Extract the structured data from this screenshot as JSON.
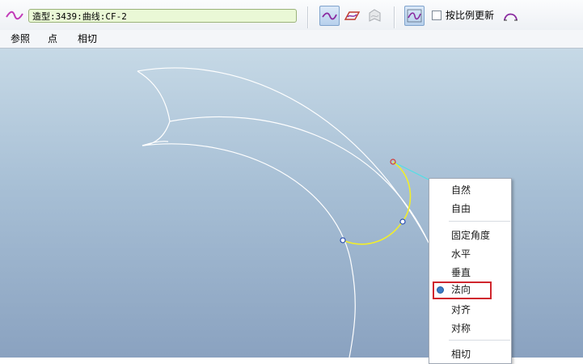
{
  "toolbar": {
    "curve_name": "造型:3439:曲线:CF-2",
    "buttons": [
      {
        "name": "curve-fit-button",
        "icon": "curve-tangent-icon",
        "active": true
      },
      {
        "name": "plane-curve-button",
        "icon": "planar-curve-icon",
        "active": false
      },
      {
        "name": "surface-curve-button",
        "icon": "surface-curve-icon",
        "active": false
      },
      {
        "name": "curvature-button",
        "icon": "curvature-plot-icon",
        "active": true
      },
      {
        "name": "proportional-update-button",
        "icon": "arch-icon",
        "active": false
      }
    ],
    "proportional_update_label": "按比例更新",
    "proportional_update_checked": false
  },
  "menubar": {
    "items": [
      "参照",
      "点",
      "相切"
    ]
  },
  "context_menu": {
    "items": [
      "自然",
      "自由",
      "固定角度",
      "水平",
      "垂直",
      "法向",
      "对齐",
      "对称",
      "相切"
    ],
    "selected": "法向"
  },
  "colors": {
    "viewport_top": "#c6d9e6",
    "viewport_bottom": "#8aa2c0",
    "curve_white": "#ffffff",
    "curve_yellow": "#f2ee2a",
    "curve_cyan": "#4fe0e6",
    "highlight_red": "#d0262d"
  }
}
